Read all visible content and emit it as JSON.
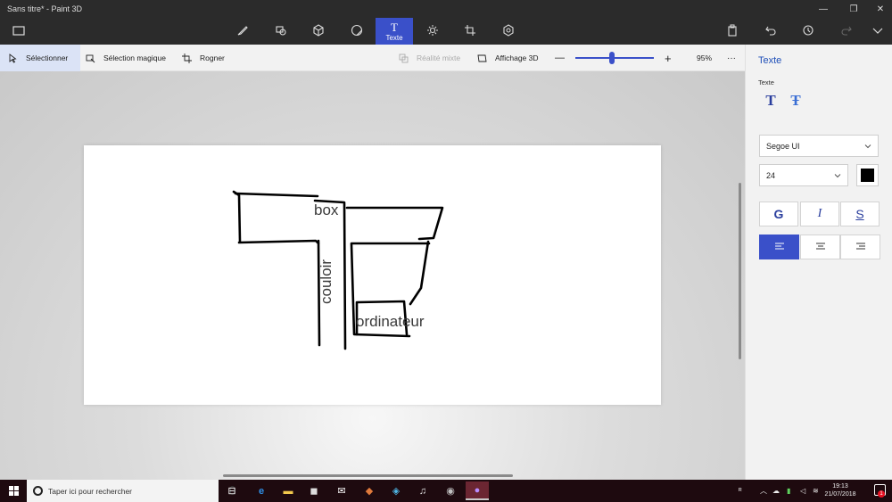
{
  "window": {
    "title": "Sans titre* - Paint 3D",
    "controls": [
      "—",
      "❐",
      "✕"
    ]
  },
  "main_toolbar": {
    "active_tool_label": "Texte",
    "active_tool_glyph": "T",
    "tools": [
      "brushes-icon",
      "2d-shapes-icon",
      "3d-shapes-icon",
      "stickers-icon",
      "text-icon",
      "effects-icon",
      "canvas-icon",
      "3d-library-icon"
    ]
  },
  "sub_toolbar": {
    "select_label": "Sélectionner",
    "magic_select_label": "Sélection magique",
    "crop_label": "Rogner",
    "mixed_reality_label": "Réalité mixte",
    "view3d_label": "Affichage 3D",
    "zoom_minus": "—",
    "zoom_plus": "+",
    "zoom_value": 95,
    "zoom_label": "95%",
    "more_label": "···"
  },
  "canvas": {
    "texts": {
      "box": "box",
      "couloir": "couloir",
      "ordinateur": "ordinateur"
    }
  },
  "panel": {
    "title": "Texte",
    "subtitle": "Texte",
    "font_family": "Segoe UI",
    "font_size": "24",
    "text_color": "#000000",
    "bold_label": "G",
    "italic_label": "I",
    "underline_label": "S",
    "alignment": "left"
  },
  "taskbar": {
    "search_placeholder": "Taper ici pour rechercher",
    "time": "19:13",
    "date": "21/07/2018",
    "notification_count": "1"
  },
  "colors": {
    "accent": "#3a50c9",
    "titlebar": "#2b2b2b",
    "taskbar": "#1e0a0f"
  }
}
